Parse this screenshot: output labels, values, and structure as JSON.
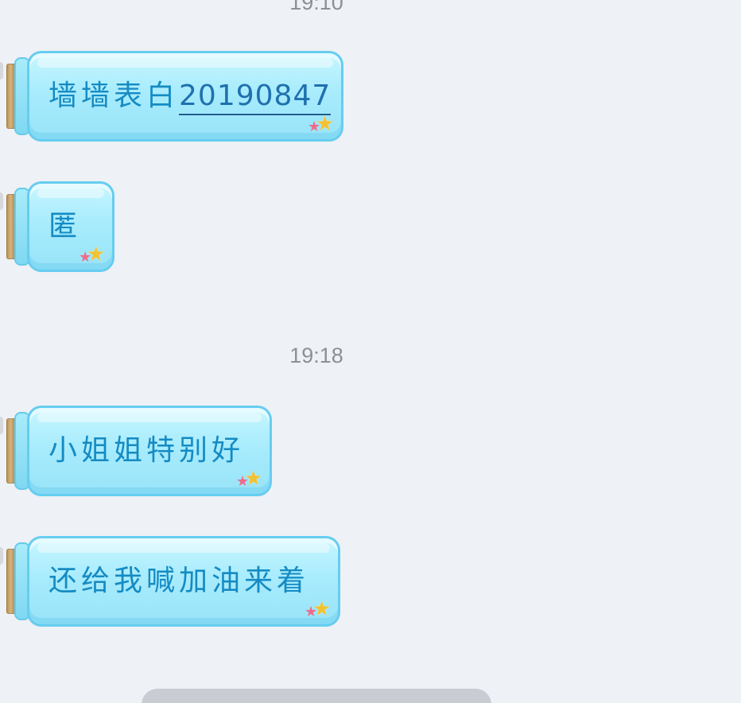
{
  "timestamps": {
    "top": "19:10",
    "mid": "19:18"
  },
  "messages": [
    {
      "text": "墙墙表白",
      "number": "20190847"
    },
    {
      "text": "匿"
    },
    {
      "text": "小姐姐特别好"
    },
    {
      "text": "还给我喊加油来着"
    }
  ],
  "icons": {
    "bubble_decoration": "stars-icon"
  },
  "colors": {
    "background": "#eef1f5",
    "bubble_border": "#66cdf0",
    "bubble_fill": "#a8ecfd",
    "text": "#158bc3",
    "timestamp": "#8d8f93",
    "cork": "#b58c4f"
  }
}
